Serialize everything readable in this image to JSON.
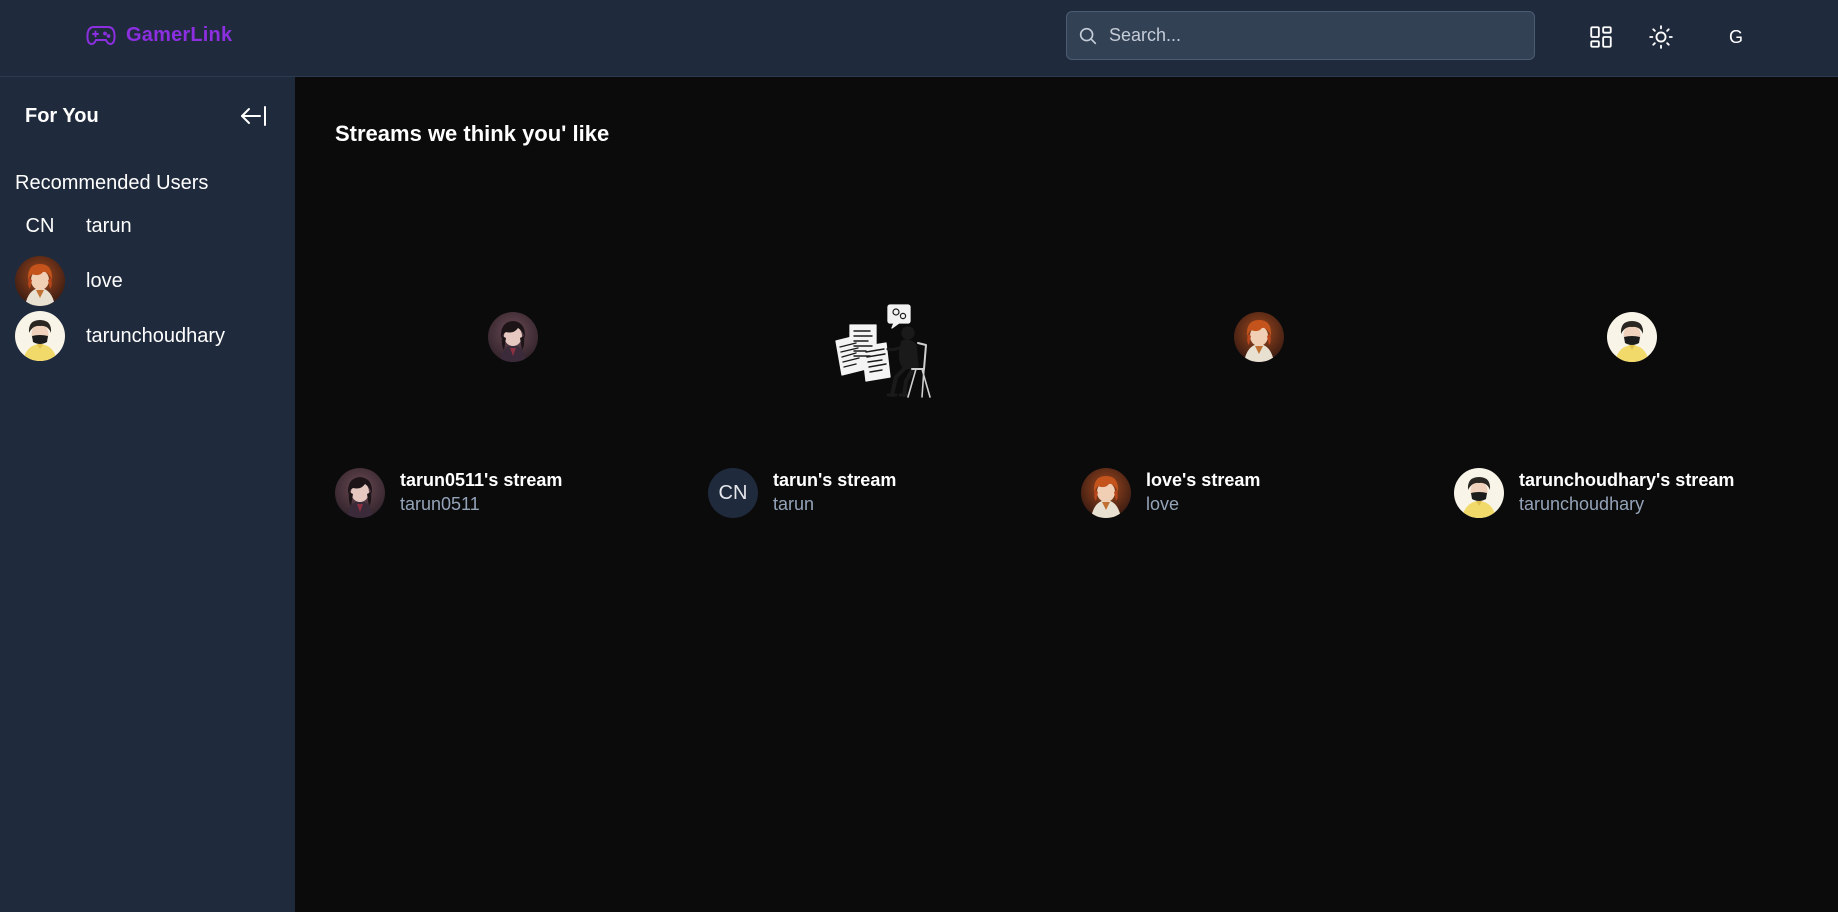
{
  "header": {
    "brand": "GamerLink",
    "search_placeholder": "Search...",
    "user_initial": "G"
  },
  "sidebar": {
    "title": "For You",
    "recommended_heading": "Recommended Users",
    "users": [
      {
        "name": "tarun",
        "avatar": "fallback",
        "fallback": "CN"
      },
      {
        "name": "love",
        "avatar": "anime-orange-hair"
      },
      {
        "name": "tarunchoudhary",
        "avatar": "masked-yellow-shirt"
      }
    ]
  },
  "main": {
    "title": "Streams we think you' like",
    "streams": [
      {
        "title": "tarun0511's stream",
        "user": "tarun0511",
        "thumbnail": "avatar",
        "avatar": "anime-dark-hair"
      },
      {
        "title": "tarun's stream",
        "user": "tarun",
        "thumbnail": "illustration",
        "avatar": "fallback",
        "fallback": "CN"
      },
      {
        "title": "love's stream",
        "user": "love",
        "thumbnail": "avatar",
        "avatar": "anime-orange-hair"
      },
      {
        "title": "tarunchoudhary's stream",
        "user": "tarunchoudhary",
        "thumbnail": "avatar",
        "avatar": "masked-yellow-shirt"
      }
    ]
  },
  "colors": {
    "brand": "#8b2fe0",
    "panel": "#1f2a3c",
    "background": "#0b0b0c",
    "muted_text": "#94a3b8"
  }
}
